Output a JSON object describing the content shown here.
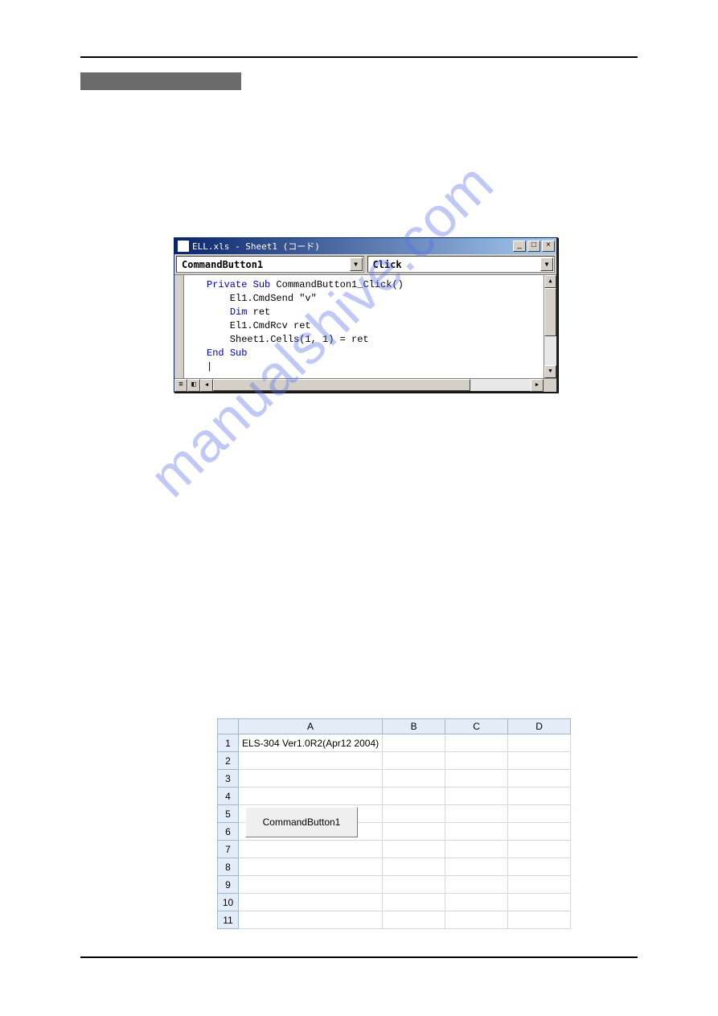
{
  "watermark": "manualshive.com",
  "vba_window": {
    "title": "ELL.xls - Sheet1 (コード)",
    "object_combo": "CommandButton1",
    "proc_combo": "Click",
    "code_lines": [
      {
        "indent": 0,
        "tokens": [
          {
            "t": "Private",
            "kw": true
          },
          {
            "t": " "
          },
          {
            "t": "Sub",
            "kw": true
          },
          {
            "t": " CommandButton1_Click()"
          }
        ]
      },
      {
        "indent": 1,
        "tokens": [
          {
            "t": "El1.CmdSend \"v\""
          }
        ]
      },
      {
        "indent": 1,
        "tokens": [
          {
            "t": "Dim",
            "kw": true
          },
          {
            "t": " ret"
          }
        ]
      },
      {
        "indent": 1,
        "tokens": [
          {
            "t": "El1.CmdRcv ret"
          }
        ]
      },
      {
        "indent": 1,
        "tokens": [
          {
            "t": "Sheet1.Cells(1, 1) = ret"
          }
        ]
      },
      {
        "indent": 0,
        "tokens": [
          {
            "t": "End",
            "kw": true
          },
          {
            "t": " "
          },
          {
            "t": "Sub",
            "kw": true
          }
        ]
      },
      {
        "indent": 0,
        "tokens": [
          {
            "t": "|"
          }
        ]
      }
    ],
    "win_buttons": {
      "min": "_",
      "max": "□",
      "close": "×"
    }
  },
  "excel": {
    "columns": [
      "A",
      "B",
      "C",
      "D"
    ],
    "rows": [
      "1",
      "2",
      "3",
      "4",
      "5",
      "6",
      "7",
      "8",
      "9",
      "10",
      "11"
    ],
    "cell_A1": "ELS-304 Ver1.0R2(Apr12 2004)",
    "button_label": "CommandButton1"
  }
}
